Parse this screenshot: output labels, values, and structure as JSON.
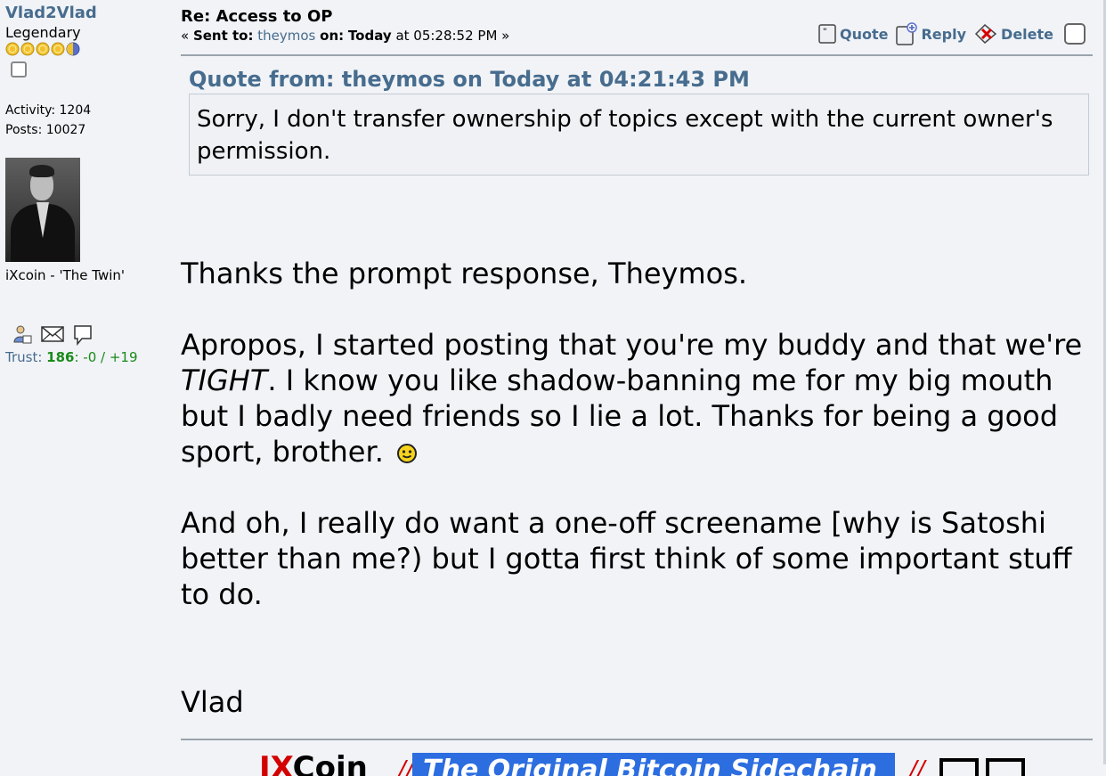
{
  "poster": {
    "username": "Vlad2Vlad",
    "rank": "Legendary",
    "stars": {
      "count": 5,
      "full": 4,
      "colors": {
        "gold": "#f2c12e",
        "blue": "#5a70c8"
      }
    },
    "activity_label": "Activity:",
    "activity": "1204",
    "posts_label": "Posts:",
    "posts": "10027",
    "signature_text": "iXcoin - 'The Twin'",
    "contact_icons": [
      "profile-icon",
      "email-icon",
      "message-icon"
    ],
    "trust": {
      "label": "Trust:",
      "score": "186",
      "delta": ": -0 / +19"
    }
  },
  "post": {
    "subject": "Re: Access to OP",
    "meta": {
      "prefix": "« ",
      "sent_to_label": "Sent to:",
      "recipient": "theymos",
      "on_label": "on:",
      "day": "Today",
      "time": "at 05:28:52 PM »"
    },
    "actions": {
      "quote": "Quote",
      "reply": "Reply",
      "delete": "Delete"
    },
    "quote": {
      "header": "Quote from: theymos on Today at 04:21:43 PM",
      "text": "Sorry, I don't transfer ownership of topics except with the current owner's permission."
    },
    "body": {
      "p1": "Thanks the prompt response, Theymos.",
      "p2_before": "Apropos, I started posting that you're my buddy and that we're ",
      "p2_italic": "TIGHT",
      "p2_after": ".  I know you like shadow-banning me for my big mouth but I badly need friends so I lie a lot.  Thanks for being a good sport, brother.",
      "p3": "And oh, I really do want a one-off screename [why is Satoshi better than me?) but I gotta first think of some important stuff to do.",
      "signoff": "Vlad"
    },
    "signature_banner": {
      "brand_ix": "IX",
      "brand_rest": "Coin",
      "slash": "//",
      "tagline": "The Original Bitcoin Sidechain"
    }
  },
  "colors": {
    "link": "#476c8e",
    "background": "#f1f3f7",
    "trust_green": "#1a8a1a",
    "banner_blue": "#2c6de0",
    "brand_red": "#d40000"
  }
}
